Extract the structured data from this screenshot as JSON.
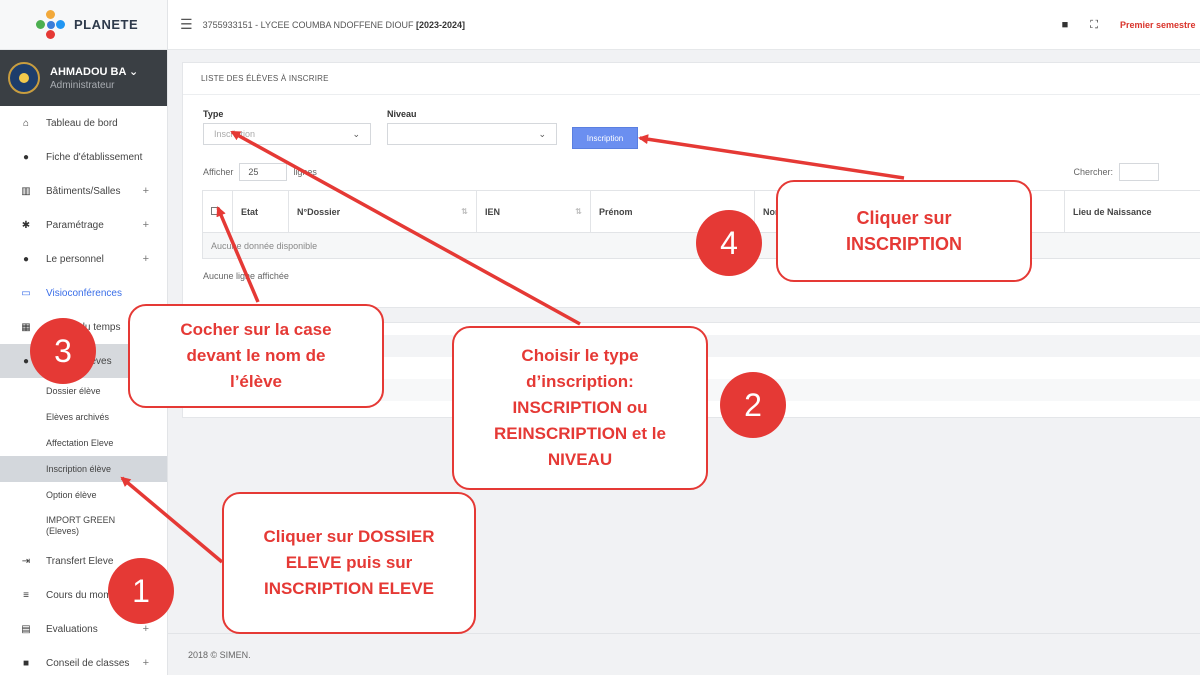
{
  "brand": {
    "name": "PLANETE"
  },
  "user": {
    "name": "AHMADOU BA",
    "caret": "⌄",
    "role": "Administrateur"
  },
  "topbar": {
    "school": "3755933151 - LYCEE COUMBA NDOFFENE DIOUF",
    "year": "[2023-2024]",
    "semester": "Premier semestre"
  },
  "menu": [
    {
      "label": "Tableau de bord",
      "icon": "home-icon",
      "plus": ""
    },
    {
      "label": "Fiche d'établissement",
      "icon": "info-icon",
      "plus": ""
    },
    {
      "label": "Bâtiments/Salles",
      "icon": "building-icon",
      "plus": "+"
    },
    {
      "label": "Paramétrage",
      "icon": "gear-icon",
      "plus": "+"
    },
    {
      "label": "Le personnel",
      "icon": "user-icon",
      "plus": "+"
    },
    {
      "label": "Visioconférences",
      "icon": "laptop-icon",
      "plus": ""
    },
    {
      "label": "Emploi du temps",
      "icon": "calendar-icon",
      "plus": ""
    },
    {
      "label": "Dossier élèves",
      "icon": "user-icon",
      "plus": ""
    }
  ],
  "submenu": [
    {
      "label": "Dossier élève"
    },
    {
      "label": "Elèves archivés"
    },
    {
      "label": "Affectation Eleve"
    },
    {
      "label": "Inscription élève"
    },
    {
      "label": "Option élève"
    },
    {
      "label": "IMPORT GREEN (Eleves)"
    }
  ],
  "menu_bottom": [
    {
      "label": "Transfert Eleve",
      "icon": "transfer-icon",
      "plus": ""
    },
    {
      "label": "Cours du moment",
      "icon": "list-icon",
      "plus": ""
    },
    {
      "label": "Evaluations",
      "icon": "clipboard-icon",
      "plus": "+"
    },
    {
      "label": "Conseil de classes",
      "icon": "folder-icon",
      "plus": "+"
    }
  ],
  "panel": {
    "title": "LISTE DES ÉLÈVES À INSCRIRE",
    "type_label": "Type",
    "type_value": "Inscription",
    "niveau_label": "Niveau",
    "niveau_value": "",
    "button": "Inscription",
    "afficher": "Afficher",
    "page_size": "25",
    "lignes": "lignes",
    "chercher": "Chercher:",
    "columns": [
      "",
      "Etat",
      "N°Dossier",
      "IEN",
      "Prénom",
      "Nom",
      "",
      "",
      "Lieu de Naissance"
    ],
    "empty": "Aucune donnée disponible",
    "info": "Aucune ligne affichée"
  },
  "footer": "2018 © SIMEN.",
  "annotations": {
    "c1": "Cliquer sur DOSSIER\nELEVE puis sur\nINSCRIPTION ELEVE",
    "c2": "Choisir le type\nd’inscription:\nINSCRIPTION ou\nREINSCRIPTION et le\nNIVEAU",
    "c3": "Cocher sur la case\ndevant le nom de\nl’élève",
    "c4": "Cliquer sur\nINSCRIPTION",
    "b1": "1",
    "b2": "2",
    "b3": "3",
    "b4": "4"
  },
  "colors": {
    "accent_red": "#e53935",
    "button_blue": "#6b8ff0",
    "sidebar_dark": "#3a3f44"
  }
}
